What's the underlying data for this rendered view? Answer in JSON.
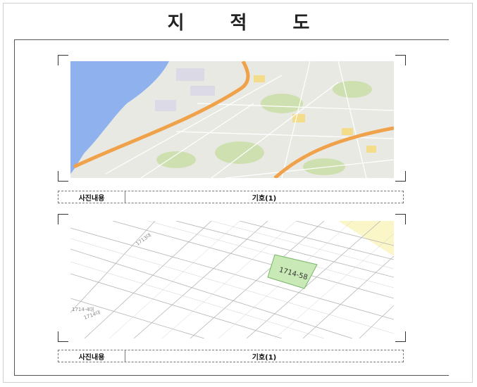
{
  "document": {
    "title": "지 적 도"
  },
  "panels": [
    {
      "caption_label": "사진내용",
      "caption_value": "기호(1)"
    },
    {
      "caption_label": "사진내용",
      "caption_value": "기호(1)",
      "parcel_label": "1714-58",
      "map_labels": [
        "1713대",
        "1714-4대",
        "1714대"
      ]
    }
  ],
  "colors": {
    "sea": "#8fb2ef",
    "land": "#e9e9e4",
    "highway": "#f0a24b",
    "parcel_fill": "#c9eab6",
    "adjacent_fill": "#fbf6c8"
  }
}
